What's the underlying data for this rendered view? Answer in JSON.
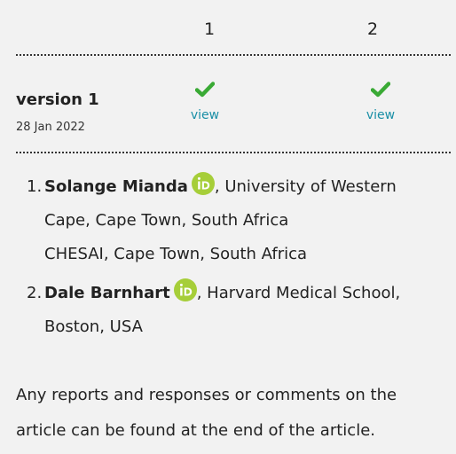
{
  "columns": [
    "1",
    "2"
  ],
  "version": {
    "title": "version 1",
    "date": "28 Jan 2022",
    "reports": [
      {
        "status_icon": "check-icon",
        "link_label": "view"
      },
      {
        "status_icon": "check-icon",
        "link_label": "view"
      }
    ]
  },
  "authors": [
    {
      "number": "1.",
      "name": "Solange Mianda",
      "affiliation_line1": ", University of Western",
      "affiliation_line2": "Cape, Cape Town, South Africa",
      "affiliation_line3": "CHESAI, Cape Town, South Africa"
    },
    {
      "number": "2.",
      "name": "Dale Barnhart",
      "affiliation_line1": ", Harvard Medical School,",
      "affiliation_line2": "Boston, USA"
    }
  ],
  "notice": {
    "line1": "Any reports and responses or comments on the",
    "line2": "article can be found at the end of the article."
  },
  "colors": {
    "check": "#3aaa35",
    "link": "#1a8fa6",
    "orcid": "#a6ce39",
    "panel_bg": "#f2f2f2"
  }
}
